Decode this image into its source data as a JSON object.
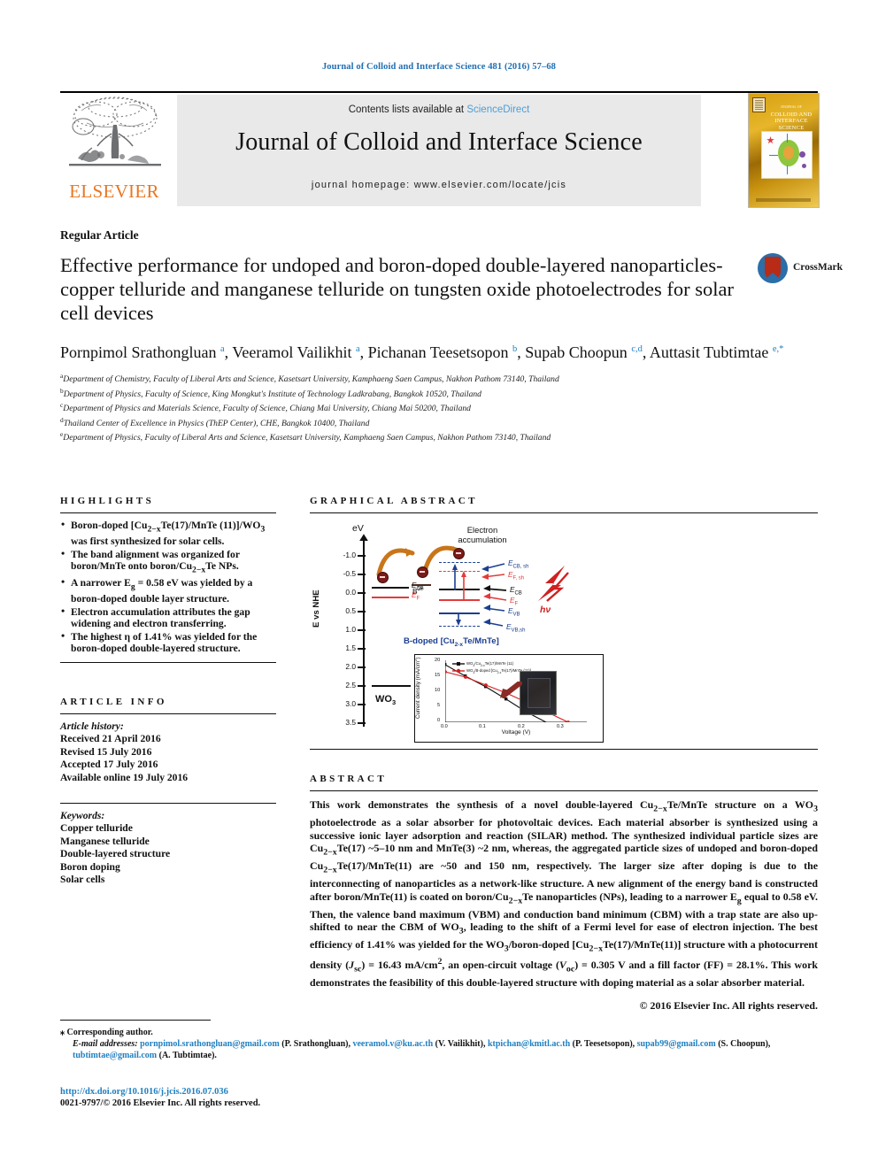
{
  "running_head": "Journal of Colloid and Interface Science 481 (2016) 57–68",
  "masthead": {
    "contents_prefix": "Contents lists available at ",
    "sciencedirect": "ScienceDirect",
    "journal_title": "Journal of Colloid and Interface Science",
    "homepage": "journal homepage: www.elsevier.com/locate/jcis",
    "publisher_logo_text": "ELSEVIER",
    "cover_title_small": "JOURNAL OF",
    "cover_title": "COLLOID AND INTERFACE SCIENCE"
  },
  "article": {
    "type": "Regular Article",
    "title": "Effective performance for undoped and boron-doped double-layered nanoparticles-copper telluride and manganese telluride on tungsten oxide photoelectrodes for solar cell devices",
    "crossmark_label": "CrossMark",
    "authors_html": "Pornpimol Srathongluan <sup>a</sup>, Veeramol Vailikhit <sup>a</sup>, Pichanan Teesetsopon <sup>b</sup>, Supab Choopun <sup>c,d</sup>, Auttasit Tubtimtae <sup>e,*</sup>",
    "affiliations": [
      {
        "mark": "a",
        "text": "Department of Chemistry, Faculty of Liberal Arts and Science, Kasetsart University, Kamphaeng Saen Campus, Nakhon Pathom 73140, Thailand"
      },
      {
        "mark": "b",
        "text": "Department of Physics, Faculty of Science, King Mongkut's Institute of Technology Ladkrabang, Bangkok 10520, Thailand"
      },
      {
        "mark": "c",
        "text": "Department of Physics and Materials Science, Faculty of Science, Chiang Mai University, Chiang Mai 50200, Thailand"
      },
      {
        "mark": "d",
        "text": "Thailand Center of Excellence in Physics (ThEP Center), CHE, Bangkok 10400, Thailand"
      },
      {
        "mark": "e",
        "text": "Department of Physics, Faculty of Liberal Arts and Science, Kasetsart University, Kamphaeng Saen Campus, Nakhon Pathom 73140, Thailand"
      }
    ]
  },
  "highlights": {
    "heading": "HIGHLIGHTS",
    "items_html": [
      "Boron-doped [Cu<sub>2&minus;x</sub>Te(17)/MnTe (11)]/WO<sub>3</sub> was first synthesized for solar cells.",
      "The band alignment was organized for boron/MnTe onto boron/Cu<sub>2&minus;x</sub>Te NPs.",
      "A narrower E<sub>g</sub> = 0.58 eV was yielded by a boron-doped double layer structure.",
      "Electron accumulation attributes the gap widening and electron transferring.",
      "The highest &eta; of 1.41% was yielded for the boron-doped double-layered structure."
    ]
  },
  "article_info": {
    "heading": "ARTICLE INFO",
    "history_label": "Article history:",
    "history": [
      "Received 21 April 2016",
      "Revised 15 July 2016",
      "Accepted 17 July 2016",
      "Available online 19 July 2016"
    ],
    "keywords_label": "Keywords:",
    "keywords": [
      "Copper telluride",
      "Manganese telluride",
      "Double-layered structure",
      "Boron doping",
      "Solar cells"
    ]
  },
  "graphical_abstract": {
    "heading": "GRAPHICAL ABSTRACT"
  },
  "abstract": {
    "heading": "ABSTRACT",
    "text_html": "This work demonstrates the synthesis of a novel double-layered Cu<sub>2&minus;x</sub>Te/MnTe structure on a WO<sub>3</sub> photoelectrode as a solar absorber for photovoltaic devices. Each material absorber is synthesized using a successive ionic layer adsorption and reaction (SILAR) method. The synthesized individual particle sizes are Cu<sub>2&minus;x</sub>Te(17) ~5&ndash;10 nm and MnTe(3) ~2 nm, whereas, the aggregated particle sizes of undoped and boron-doped Cu<sub>2&minus;x</sub>Te(17)/MnTe(11) are ~50 and 150 nm, respectively. The larger size after doping is due to the interconnecting of nanoparticles as a network-like structure. A new alignment of the energy band is constructed after boron/MnTe(11) is coated on boron/Cu<sub>2&minus;x</sub>Te nanoparticles (NPs), leading to a narrower E<sub>g</sub> equal to 0.58 eV. Then, the valence band maximum (VBM) and conduction band minimum (CBM) with a trap state are also up-shifted to near the CBM of WO<sub>3</sub>, leading to the shift of a Fermi level for ease of electron injection. The best efficiency of 1.41% was yielded for the WO<sub>3</sub>/boron-doped [Cu<sub>2&minus;x</sub>Te(17)/MnTe(11)] structure with a photocurrent density (<i>J</i><sub>sc</sub>) = 16.43 mA/cm<sup>2</sup>, an open-circuit voltage (<i>V</i><sub>oc</sub>) = 0.305 V and a fill factor (FF) = 28.1%. This work demonstrates the feasibility of this double-layered structure with doping material as a solar absorber material.",
    "copyright": "© 2016 Elsevier Inc. All rights reserved."
  },
  "footnotes": {
    "corresponding": "Corresponding author.",
    "email_label": "E-mail addresses:",
    "emails": [
      {
        "address": "pornpimol.srathongluan@gmail.com",
        "person": "(P. Srathongluan)"
      },
      {
        "address": "veeramol.v@ku.ac.th",
        "person": "(V. Vailikhit)"
      },
      {
        "address": "ktpichan@kmitl.ac.th",
        "person": "(P. Teesetsopon)"
      },
      {
        "address": "supab99@gmail.com",
        "person": "(S. Choopun)"
      },
      {
        "address": "tubtimtae@gmail.com",
        "person": "(A. Tubtimtae)"
      }
    ],
    "doi": "http://dx.doi.org/10.1016/j.jcis.2016.07.036",
    "issn_line": "0021-9797/© 2016 Elsevier Inc. All rights reserved."
  },
  "chart_data": [
    {
      "type": "line",
      "name": "energy-band-diagram",
      "title": "B-doped [Cu2-xTe/MnTe]",
      "ylabel": "E vs NHE",
      "y_unit": "eV",
      "ytick_labels": [
        "-1.0",
        "-0.5",
        "0.0",
        "0.5",
        "1.0",
        "1.5",
        "2.0",
        "2.5",
        "3.0",
        "3.5"
      ],
      "annotations": [
        "Electron accumulation",
        "E_CB,sh",
        "E_F,sh",
        "E_CB",
        "E_F",
        "E_VB",
        "E_VB,sh",
        "hv",
        "B3+",
        "WO3",
        "E_CB",
        "E_F",
        "E_VB"
      ],
      "levels": [
        {
          "label": "E_CB",
          "series": "Cu2-xTe",
          "value": -0.5
        },
        {
          "label": "E_F",
          "series": "Cu2-xTe",
          "value": -0.35
        },
        {
          "label": "E_CB,sh",
          "series": "MnTe-shifted",
          "value": -1.0
        },
        {
          "label": "E_F,sh",
          "series": "MnTe-shifted",
          "value": -0.85
        },
        {
          "label": "E_CB",
          "series": "MnTe",
          "value": -0.45
        },
        {
          "label": "E_F",
          "series": "MnTe",
          "value": -0.2
        },
        {
          "label": "E_VB",
          "series": "MnTe",
          "value": 0.1
        },
        {
          "label": "E_VB,sh",
          "series": "MnTe-shifted",
          "value": 0.35
        },
        {
          "label": "E_VB",
          "series": "WO3",
          "value": 2.0
        },
        {
          "label": "E_CB",
          "series": "WO3",
          "value": 0.05
        }
      ]
    },
    {
      "type": "line",
      "name": "jv-curve-inset",
      "xlabel": "Voltage (V)",
      "ylabel": "Current density (mA/cm2)",
      "xlim": [
        0.0,
        0.35
      ],
      "ylim": [
        0,
        20
      ],
      "xtick_labels": [
        "0.0",
        "0.1",
        "0.2",
        "0.3"
      ],
      "ytick_labels": [
        "0",
        "5",
        "10",
        "15",
        "20"
      ],
      "legend_position": "top-left",
      "series": [
        {
          "name": "WO3/Cu2-xTe(17)/MnTe (11)",
          "color": "#111111",
          "x": [
            0.0,
            0.05,
            0.1,
            0.15,
            0.2,
            0.25
          ],
          "y": [
            18.5,
            14.8,
            11.3,
            7.3,
            3.4,
            0.0
          ]
        },
        {
          "name": "WO3/B-doped [Cu2-xTe(17)/MnTe (11)]",
          "color": "#d32020",
          "x": [
            0.0,
            0.05,
            0.1,
            0.15,
            0.2,
            0.25,
            0.305
          ],
          "y": [
            16.4,
            14.7,
            12.1,
            9.4,
            6.6,
            3.5,
            0.0
          ]
        }
      ]
    }
  ]
}
